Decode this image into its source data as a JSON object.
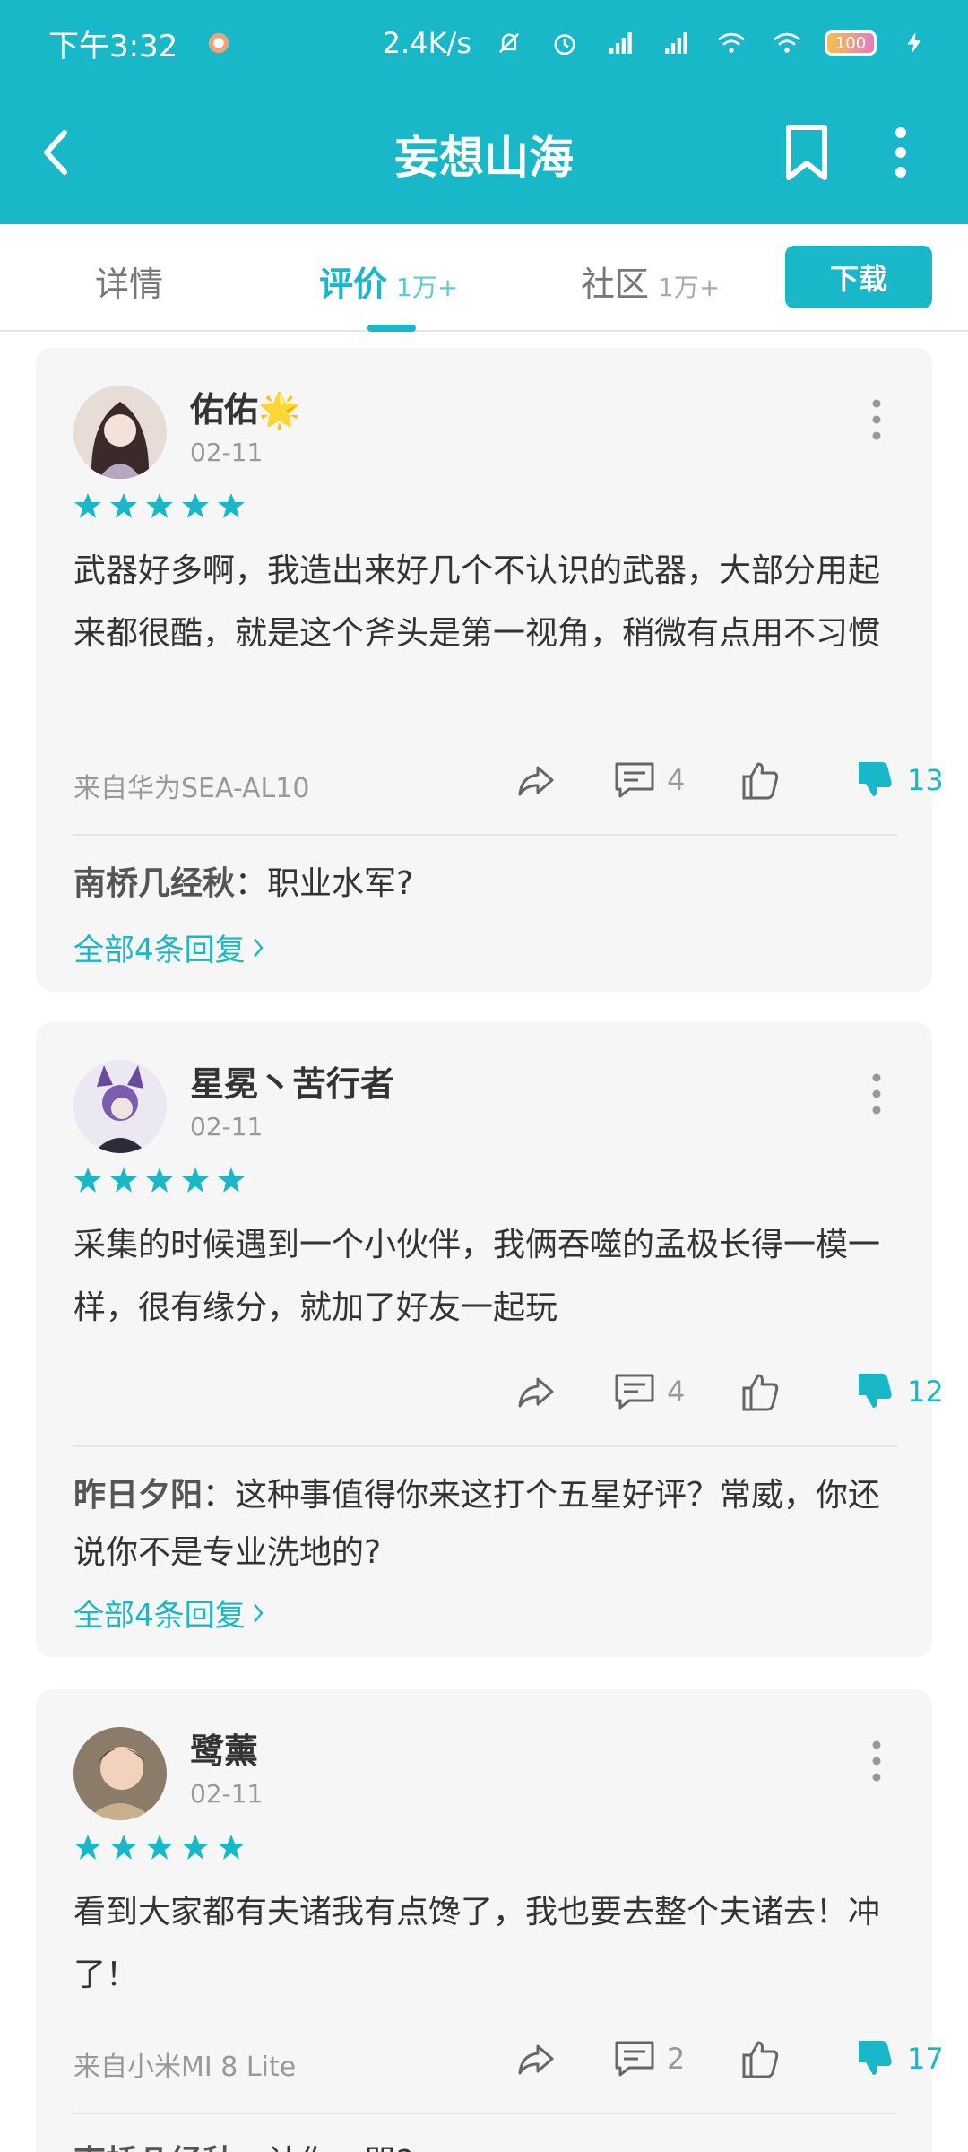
{
  "status_bar": {
    "time": "下午3:32",
    "net_speed": "2.4K/s",
    "battery": "100"
  },
  "header": {
    "title": "妄想山海"
  },
  "tabs": [
    {
      "label": "详情",
      "count": ""
    },
    {
      "label": "评价",
      "count": "1万+"
    },
    {
      "label": "社区",
      "count": "1万+"
    }
  ],
  "download_label": "下载",
  "colors": {
    "accent": "#18b8c8",
    "card_bg": "#f6f6f6"
  },
  "reviews": [
    {
      "username": "佑佑",
      "badge": "🌟",
      "date": "02-11",
      "rating": 5,
      "text": "武器好多啊，我造出来好几个不认识的武器，大部分用起来都很酷，就是这个斧头是第一视角，稍微有点用不习惯",
      "device": "来自华为SEA-AL10",
      "comments": "4",
      "dislikes": "13",
      "reply_user": "南桥几经秋",
      "reply_text": "：职业水军?",
      "all_replies": "全部4条回复"
    },
    {
      "username": "星冕丶苦行者",
      "date": "02-11",
      "rating": 5,
      "text": "采集的时候遇到一个小伙伴，我俩吞噬的孟极长得一模一样，很有缘分，就加了好友一起玩",
      "device": "",
      "comments": "4",
      "dislikes": "12",
      "reply_user": "昨日夕阳",
      "reply_text": "：这种事值得你来这打个五星好评？常威，你还说你不是专业洗地的?",
      "all_replies": "全部4条回复"
    },
    {
      "username": "鹭薰",
      "date": "02-11",
      "rating": 5,
      "text": "看到大家都有夫诸我有点馋了，我也要去整个夫诸去！冲了！",
      "device": "来自小米MI 8 Lite",
      "comments": "2",
      "dislikes": "17",
      "reply_user": "南桥几经秋",
      "reply_text": "：计你一哭?"
    }
  ]
}
